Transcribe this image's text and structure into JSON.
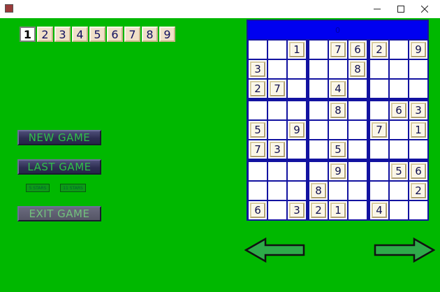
{
  "window": {
    "title": "",
    "controls": [
      "minimize",
      "maximize",
      "close"
    ]
  },
  "number_selector": {
    "digits": [
      "1",
      "2",
      "3",
      "4",
      "5",
      "6",
      "7",
      "8",
      "9"
    ],
    "selected": "1"
  },
  "buttons": {
    "new_game": "NEW GAME",
    "last_game": "LAST GAME",
    "stars_5": "5 STARS",
    "stars_11": "11 STARS",
    "exit_game": "EXIT GAME"
  },
  "board": {
    "header": "0",
    "header_color": "#0000f0",
    "grid": [
      [
        "",
        "",
        "1",
        "",
        "7",
        "6",
        "2",
        "",
        "9"
      ],
      [
        "3",
        "",
        "",
        "",
        "",
        "8",
        "",
        "",
        ""
      ],
      [
        "2",
        "7",
        "",
        "",
        "4",
        "",
        "",
        "",
        ""
      ],
      [
        "",
        "",
        "",
        "",
        "8",
        "",
        "",
        "6",
        "3"
      ],
      [
        "5",
        "",
        "9",
        "",
        "",
        "",
        "7",
        "",
        "1"
      ],
      [
        "7",
        "3",
        "",
        "",
        "5",
        "",
        "",
        "",
        ""
      ],
      [
        "",
        "",
        "",
        "",
        "9",
        "",
        "",
        "5",
        "6"
      ],
      [
        "",
        "",
        "",
        "8",
        "",
        "",
        "",
        "",
        "2"
      ],
      [
        "6",
        "",
        "3",
        "2",
        "1",
        "",
        "4",
        "",
        ""
      ]
    ]
  },
  "navigation": {
    "prev": "left-arrow",
    "next": "right-arrow"
  },
  "colors": {
    "background": "#00b800",
    "board_border": "#1212a0",
    "arrow_fill": "#2eaa4a"
  }
}
